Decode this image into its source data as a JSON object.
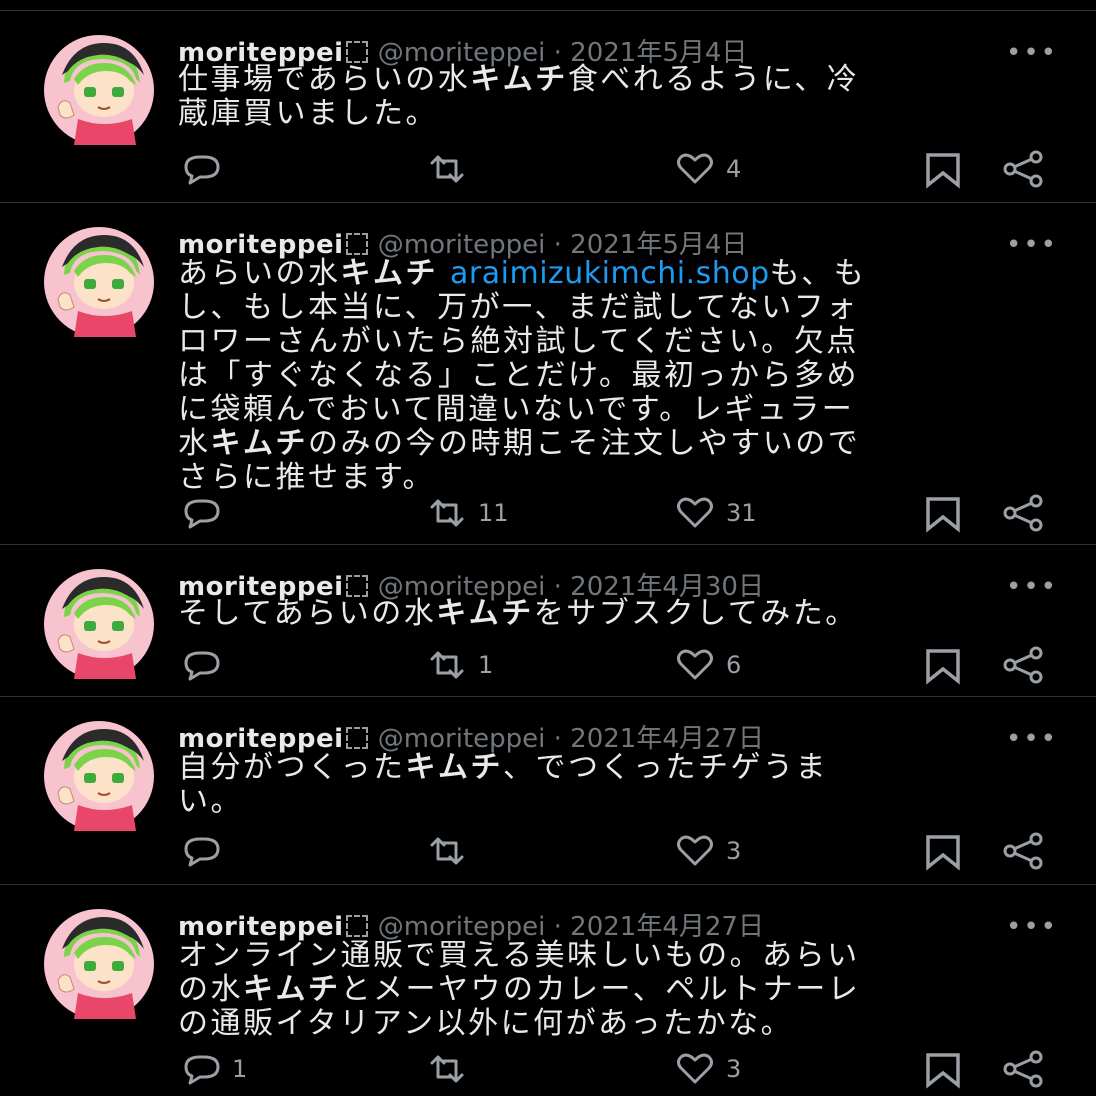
{
  "tweets": [
    {
      "name": "moriteppei",
      "handle": "@moriteppei",
      "dot": "·",
      "date": "2021年5月4日",
      "more": "•••",
      "body": [
        {
          "t": "仕事場であらいの水"
        },
        {
          "t": "キムチ",
          "b": true
        },
        {
          "t": "食べれるように、冷\n蔵庫買いました。"
        }
      ],
      "replies": "",
      "retweets": "",
      "likes": "4"
    },
    {
      "name": "moriteppei",
      "handle": "@moriteppei",
      "dot": "·",
      "date": "2021年5月4日",
      "more": "•••",
      "body": [
        {
          "t": "あらいの水"
        },
        {
          "t": "キムチ",
          "b": true
        },
        {
          "t": " "
        },
        {
          "t": "araimizukimchi.shop",
          "link": true
        },
        {
          "t": "も、も\nし、もし本当に、万が一、まだ試してないフォ\nロワーさんがいたら絶対試してください。欠点\nは「すぐなくなる」ことだけ。最初っから多め\nに袋頼んでおいて間違いないです。レギュラー\n水"
        },
        {
          "t": "キムチ",
          "b": true
        },
        {
          "t": "のみの今の時期こそ注文しやすいので\nさらに推せます。"
        }
      ],
      "replies": "",
      "retweets": "11",
      "likes": "31"
    },
    {
      "name": "moriteppei",
      "handle": "@moriteppei",
      "dot": "·",
      "date": "2021年4月30日",
      "more": "•••",
      "body": [
        {
          "t": "そしてあらいの水"
        },
        {
          "t": "キムチ",
          "b": true
        },
        {
          "t": "をサブスクしてみた。"
        }
      ],
      "replies": "",
      "retweets": "1",
      "likes": "6"
    },
    {
      "name": "moriteppei",
      "handle": "@moriteppei",
      "dot": "·",
      "date": "2021年4月27日",
      "more": "•••",
      "body": [
        {
          "t": "自分がつくった"
        },
        {
          "t": "キムチ",
          "b": true
        },
        {
          "t": "、でつくったチゲうま\nい。"
        }
      ],
      "replies": "",
      "retweets": "",
      "likes": "3"
    },
    {
      "name": "moriteppei",
      "handle": "@moriteppei",
      "dot": "·",
      "date": "2021年4月27日",
      "more": "•••",
      "body": [
        {
          "t": "オンライン通販で買える美味しいもの。あらい\nの水"
        },
        {
          "t": "キムチ",
          "b": true
        },
        {
          "t": "とメーヤウのカレー、ペルトナーレ\nの通販イタリアン以外に何があったかな。"
        }
      ],
      "replies": "1",
      "retweets": "",
      "likes": "3"
    }
  ],
  "icons": {
    "avatar": "avatar-green-hair-character",
    "reply": "speech-bubble-icon",
    "retweet": "retweet-arrows-icon",
    "like": "heart-icon",
    "bookmark": "bookmark-icon",
    "share": "share-nodes-icon"
  },
  "colors": {
    "background": "#000000",
    "text": "#e7e9ea",
    "muted": "#71767b",
    "link": "#1d9bf0",
    "divider": "#2f3336"
  }
}
